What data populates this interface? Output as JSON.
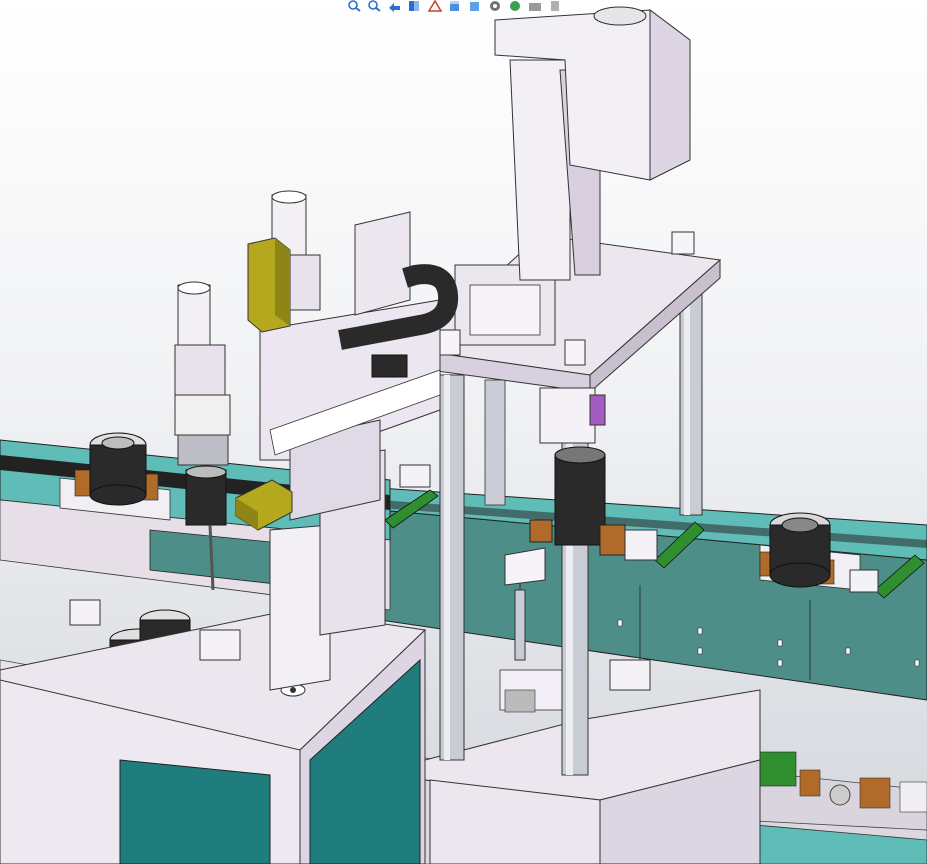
{
  "app": "CAD 3D viewport",
  "viewport": {
    "background_top": "#ffffff",
    "background_bottom": "#d3d6dc"
  },
  "toolbar": {
    "items": [
      {
        "name": "zoom-to-fit-icon",
        "color": "#2b6fd0"
      },
      {
        "name": "zoom-to-area-icon",
        "color": "#2b6fd0"
      },
      {
        "name": "previous-view-icon",
        "color": "#2b6fd0"
      },
      {
        "name": "section-view-icon",
        "color": "#2b6fd0"
      },
      {
        "name": "dynamic-annotation-icon",
        "color": "#c8402a"
      },
      {
        "name": "view-orientation-icon",
        "color": "#4a8fe0"
      },
      {
        "name": "display-style-icon",
        "color": "#5ea0e8"
      },
      {
        "name": "hide-show-items-icon",
        "color": "#707070"
      },
      {
        "name": "edit-appearance-icon",
        "color": "#3aa04a"
      },
      {
        "name": "apply-scene-icon",
        "color": "#9a9a9a"
      },
      {
        "name": "view-settings-icon",
        "color": "#b0b0b0"
      }
    ]
  },
  "colors": {
    "frame": "#e6dfe8",
    "frame_edge": "#4a4a4a",
    "teal_panel": "#1f7d7d",
    "conveyor": "#4d8f88",
    "conveyor_top": "#5fbcb6",
    "rod": "#c9ccd4",
    "yellow_motor": "#b4a81e",
    "black_part": "#2a2a2a",
    "green_rail": "#2f8f2f",
    "orange_block": "#b06a2a"
  }
}
